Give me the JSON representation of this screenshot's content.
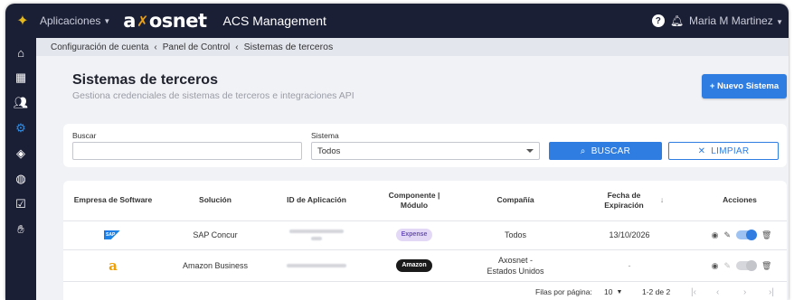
{
  "topbar": {
    "apps_label": "Aplicaciones",
    "brand": "axosnet",
    "app_title": "ACS Management",
    "help_label": "?",
    "user_name": "Maria M Martinez"
  },
  "breadcrumb": {
    "items": [
      "Configuración de cuenta",
      "Panel de Control",
      "Sistemas de terceros"
    ]
  },
  "page": {
    "title": "Sistemas de terceros",
    "subtitle": "Gestiona credenciales de sistemas de terceros e integraciones API",
    "new_button": "+ Nuevo Sistema"
  },
  "filters": {
    "search_label": "Buscar",
    "search_value": "",
    "system_label": "Sistema",
    "system_selected": "Todos",
    "search_button": "BUSCAR",
    "clear_button": "LIMPIAR"
  },
  "table": {
    "headers": {
      "empresa": "Empresa de Software",
      "solucion": "Solución",
      "id_app": "ID de Aplicación",
      "componente": "Componente | Módulo",
      "compania": "Compañía",
      "fecha": "Fecha de Expiración",
      "acciones": "Acciones"
    },
    "rows": [
      {
        "empresa_logo": "SAP",
        "solucion": "SAP Concur",
        "componente": "Expense",
        "compania": "Todos",
        "fecha": "13/10/2026",
        "active": true
      },
      {
        "empresa_logo": "a",
        "solucion": "Amazon Business",
        "componente": "Amazon",
        "compania": "Axosnet - Estados Unidos",
        "fecha": "-",
        "active": false
      }
    ]
  },
  "pagination": {
    "rows_per_page_label": "Filas por página:",
    "rows_per_page": "10",
    "range": "1-2 de 2"
  },
  "colors": {
    "nav_bg": "#1b1f36",
    "accent": "#2f7de1",
    "page_bg": "#f1f2f6",
    "brand_accent": "#e8a21a"
  }
}
